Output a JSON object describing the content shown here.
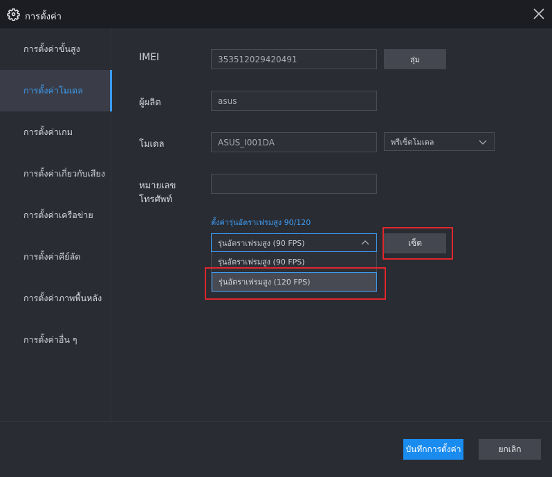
{
  "window": {
    "title": "การตั้งค่า",
    "icon": "gear-icon",
    "close_icon": "close-icon"
  },
  "sidebar": {
    "items": [
      {
        "label": "การตั้งค่าขั้นสูง",
        "active": false
      },
      {
        "label": "การตั้งค่าโมเดล",
        "active": true
      },
      {
        "label": "การตั้งค่าเกม",
        "active": false
      },
      {
        "label": "การตั้งค่าเกี่ยวกับเสียง",
        "active": false
      },
      {
        "label": "การตั้งค่าเครือข่าย",
        "active": false
      },
      {
        "label": "การตั้งค่าคีย์ลัด",
        "active": false
      },
      {
        "label": "การตั้งค่าภาพพื้นหลัง",
        "active": false
      },
      {
        "label": "การตั้งค่าอื่น ๆ",
        "active": false
      }
    ]
  },
  "form": {
    "imei_label": "IMEI",
    "imei_value": "353512029420491",
    "random_button": "สุ่ม",
    "manufacturer_label": "ผู้ผลิต",
    "manufacturer_value": "asus",
    "model_label": "โมเดล",
    "model_value": "ASUS_I001DA",
    "preset_select": "พรีเซ็ตโมเดล",
    "phone_label_line1": "หมายเลข",
    "phone_label_line2": "โทรศัพท์",
    "phone_value": "",
    "high_fps_link": "ตั้งค่ารุ่นอัตราเฟรมสูง 90/120",
    "fps_selected": "รุ่นอัตราเฟรมสูง (90 FPS)",
    "fps_options": [
      "รุ่นอัตราเฟรมสูง (90 FPS)",
      "รุ่นอัตราเฟรมสูง (120 FPS)"
    ],
    "set_button": "เซ็ต"
  },
  "footer": {
    "save_button": "บันทึกการตั้งค่า",
    "cancel_button": "ยกเลิก"
  },
  "colors": {
    "accent": "#3b9cf3",
    "primary_button": "#1a8cf0",
    "highlight_border": "#e0262c",
    "background": "#2a2c33",
    "titlebar": "#1c1d22"
  }
}
